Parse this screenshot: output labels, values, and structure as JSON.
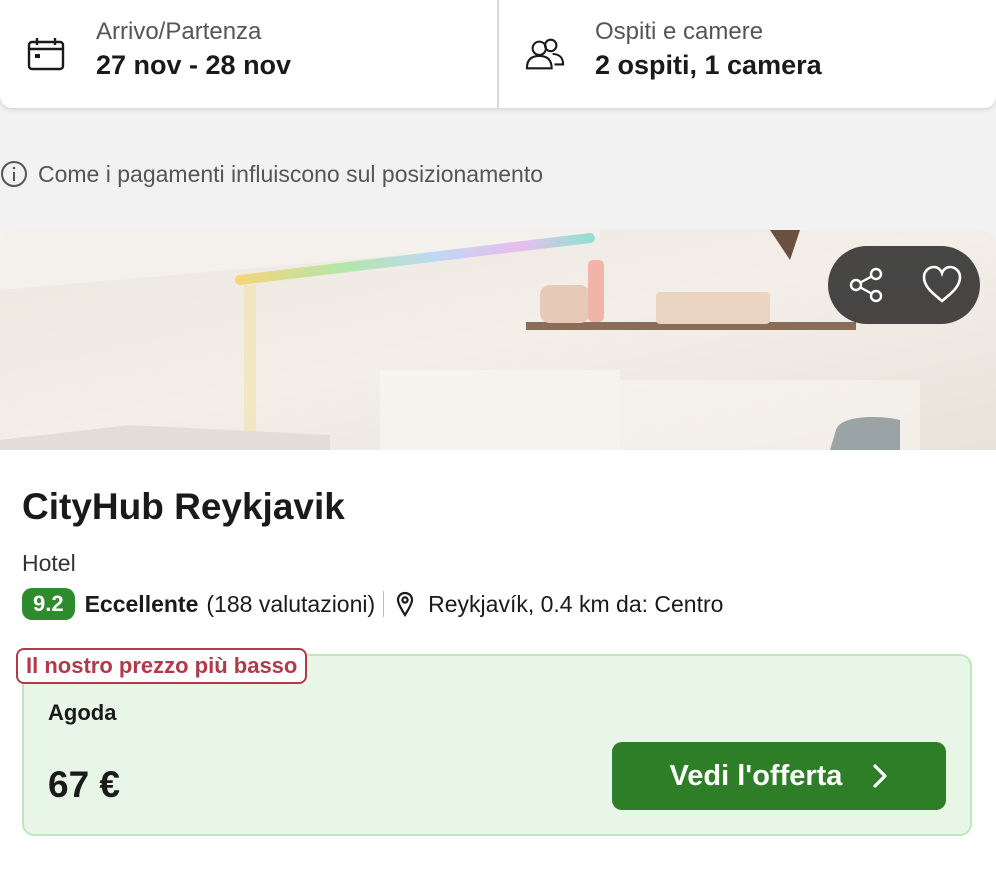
{
  "search": {
    "dates": {
      "label": "Arrivo/Partenza",
      "value": "27 nov - 28 nov",
      "icon": "calendar-icon"
    },
    "guests": {
      "label": "Ospiti e camere",
      "value": "2 ospiti, 1 camera",
      "icon": "users-icon"
    }
  },
  "info": {
    "text": "Come i pagamenti influiscono sul posizionamento",
    "icon": "info-icon"
  },
  "hotel": {
    "name": "CityHub Reykjavik",
    "type": "Hotel",
    "score": "9.2",
    "rating_word": "Eccellente",
    "reviews": "(188 valutazioni)",
    "location": "Reykjavík, 0.4 km da: Centro",
    "actions": {
      "share_icon": "share-icon",
      "favorite_icon": "heart-icon"
    }
  },
  "offer": {
    "badge": "Il nostro prezzo più basso",
    "provider": "Agoda",
    "price": "67 €",
    "cta": "Vedi l'offerta"
  },
  "colors": {
    "score_bg": "#2e8b2e",
    "cta_bg": "#2e7d27",
    "offer_bg": "#e7f6e6",
    "badge_color": "#b03a48"
  }
}
